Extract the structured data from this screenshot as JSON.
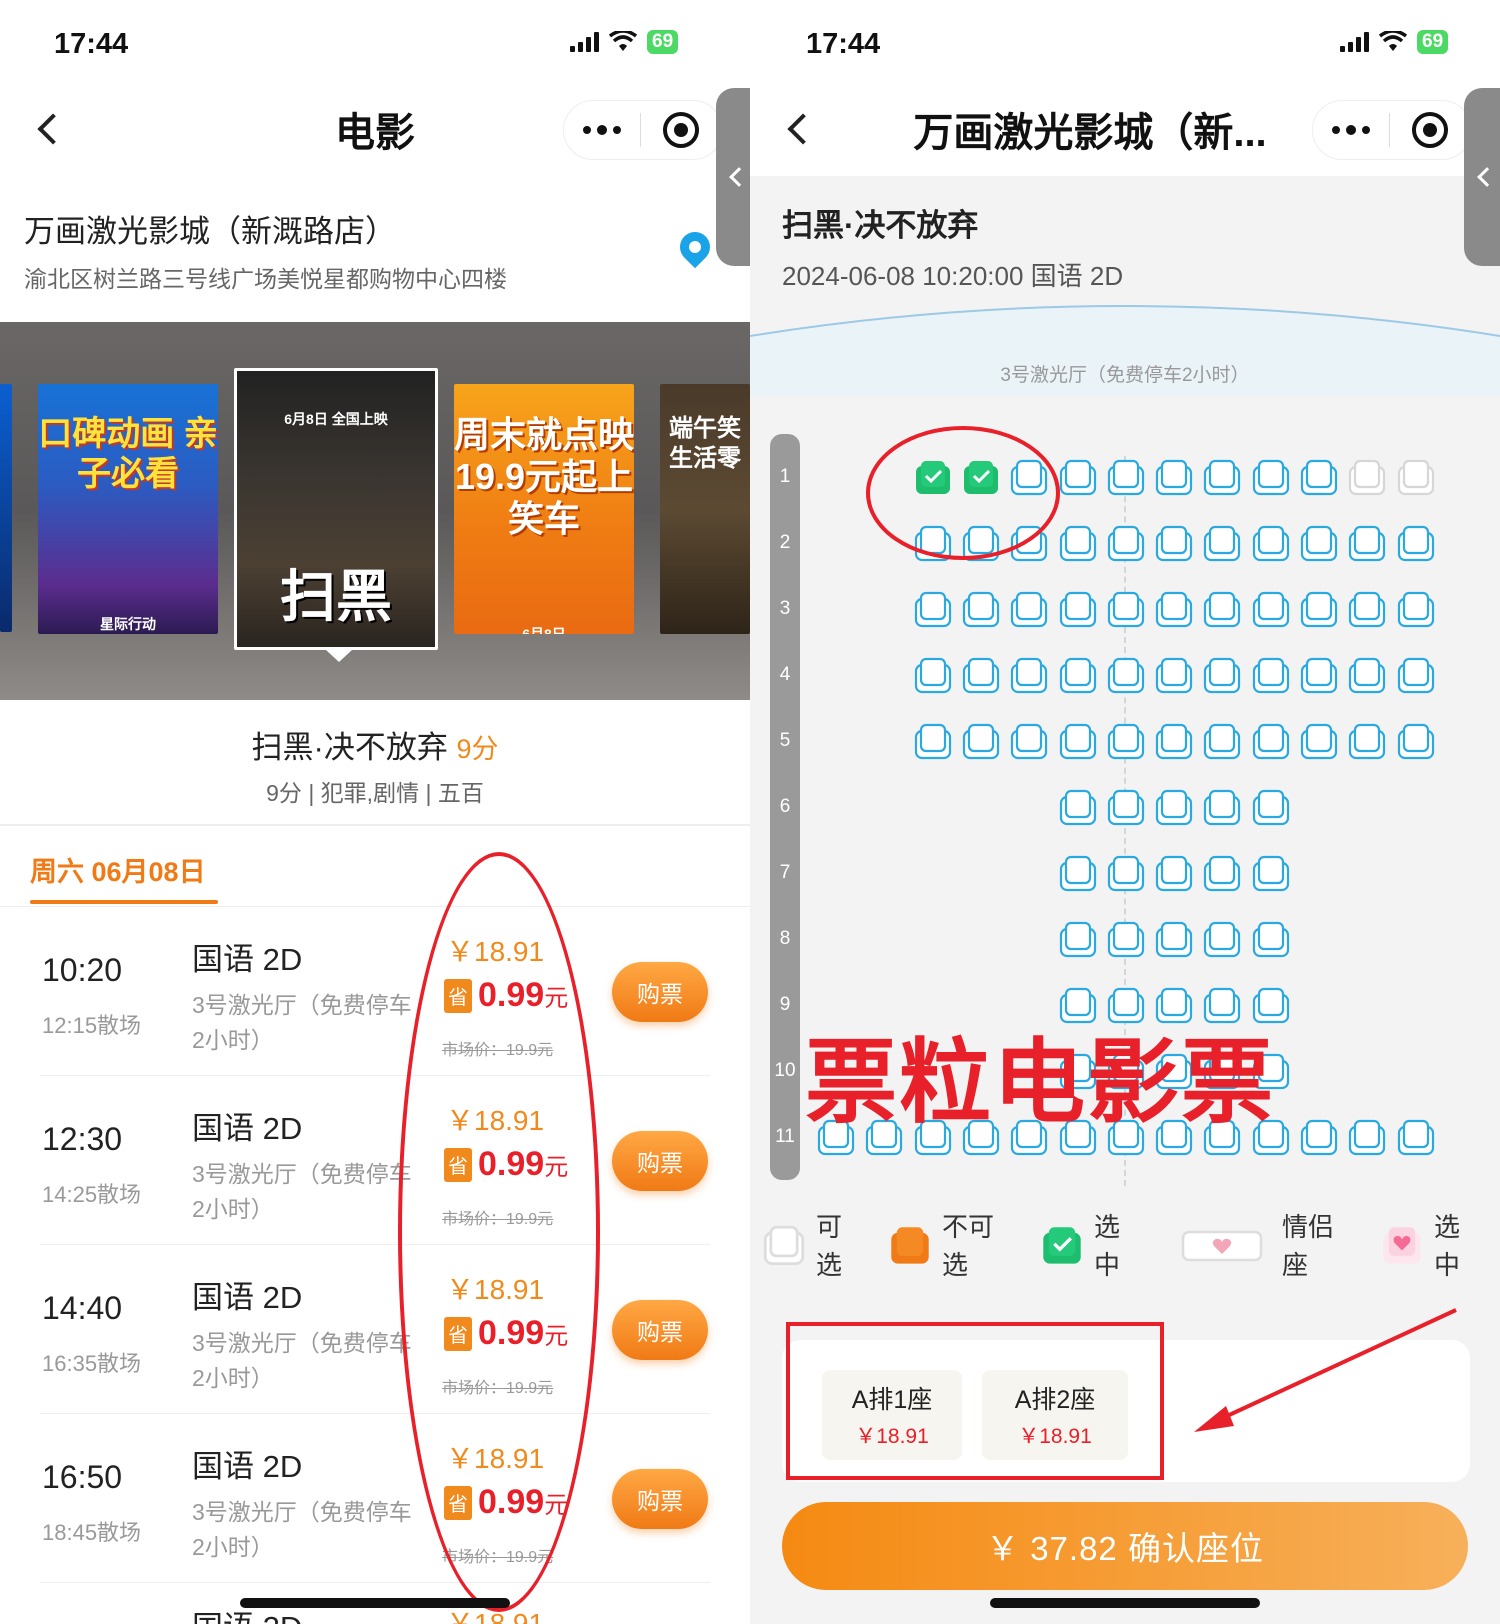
{
  "left": {
    "status": {
      "time": "17:44",
      "battery": "69"
    },
    "nav": {
      "title": "电影"
    },
    "cinema": {
      "name": "万画激光影城（新溉路店）",
      "address": "渝北区树兰路三号线广场美悦星都购物中心四楼"
    },
    "posters": [
      {
        "title": "",
        "subtitle": ""
      },
      {
        "title": "口碑动画 亲子必看",
        "subtitle": "星际行动"
      },
      {
        "title": "扫黑",
        "subtitle": "6月8日 全国上映"
      },
      {
        "title": "周末就点映 19.9元起上笑车",
        "subtitle": "6月8日"
      },
      {
        "title": "端午笑 生活零",
        "subtitle": ""
      }
    ],
    "movie": {
      "title": "扫黑·决不放弃",
      "score": "9分",
      "meta": "9分 | 犯罪,剧情 | 五百"
    },
    "date_tab": "周六 06月08日",
    "showtimes": [
      {
        "start": "10:20",
        "end": "12:15散场",
        "lang": "国语 2D",
        "hall": "3号激光厅（免费停车2小时）",
        "price": "￥18.91",
        "sale": "0.99",
        "unit": "元",
        "market": "市场价：19.9元",
        "buy": "购票"
      },
      {
        "start": "12:30",
        "end": "14:25散场",
        "lang": "国语 2D",
        "hall": "3号激光厅（免费停车2小时）",
        "price": "￥18.91",
        "sale": "0.99",
        "unit": "元",
        "market": "市场价：19.9元",
        "buy": "购票"
      },
      {
        "start": "14:40",
        "end": "16:35散场",
        "lang": "国语 2D",
        "hall": "3号激光厅（免费停车2小时）",
        "price": "￥18.91",
        "sale": "0.99",
        "unit": "元",
        "market": "市场价：19.9元",
        "buy": "购票"
      },
      {
        "start": "16:50",
        "end": "18:45散场",
        "lang": "国语 2D",
        "hall": "3号激光厅（免费停车2小时）",
        "price": "￥18.91",
        "sale": "0.99",
        "unit": "元",
        "market": "市场价：19.9元",
        "buy": "购票"
      }
    ],
    "partial_row": {
      "lang": "国语 2D",
      "price": "￥18.91"
    },
    "sheng": "省"
  },
  "right": {
    "status": {
      "time": "17:44",
      "battery": "69"
    },
    "nav": {
      "title": "万画激光影城（新..."
    },
    "movie": {
      "title": "扫黑·决不放弃",
      "info": "2024-06-08 10:20:00 国语 2D"
    },
    "hall": "3号激光厅（免费停车2小时）",
    "row_numbers": [
      "1",
      "2",
      "3",
      "4",
      "5",
      "6",
      "7",
      "8",
      "9",
      "10",
      "11"
    ],
    "seat_rows": [
      {
        "cols": [
          3,
          4,
          5,
          6,
          7,
          8,
          9,
          10,
          11,
          12,
          13
        ],
        "selected": [
          3,
          4
        ],
        "white": [
          12,
          13
        ]
      },
      {
        "cols": [
          3,
          4,
          5,
          6,
          7,
          8,
          9,
          10,
          11,
          12,
          13
        ],
        "selected": [],
        "white": []
      },
      {
        "cols": [
          3,
          4,
          5,
          6,
          7,
          8,
          9,
          10,
          11,
          12,
          13
        ],
        "selected": [],
        "white": []
      },
      {
        "cols": [
          3,
          4,
          5,
          6,
          7,
          8,
          9,
          10,
          11,
          12,
          13
        ],
        "selected": [],
        "white": []
      },
      {
        "cols": [
          3,
          4,
          5,
          6,
          7,
          8,
          9,
          10,
          11,
          12,
          13
        ],
        "selected": [],
        "white": []
      },
      {
        "cols": [
          6,
          7,
          8,
          9,
          10
        ],
        "selected": [],
        "white": []
      },
      {
        "cols": [
          6,
          7,
          8,
          9,
          10
        ],
        "selected": [],
        "white": []
      },
      {
        "cols": [
          6,
          7,
          8,
          9,
          10
        ],
        "selected": [],
        "white": []
      },
      {
        "cols": [
          6,
          7,
          8,
          9,
          10
        ],
        "selected": [],
        "white": []
      },
      {
        "cols": [
          6,
          7,
          8,
          9,
          10
        ],
        "selected": [],
        "white": []
      },
      {
        "cols": [
          1,
          2,
          3,
          4,
          5,
          6,
          7,
          8,
          9,
          10,
          11,
          12,
          13
        ],
        "selected": [],
        "white": []
      }
    ],
    "watermark": "票粒电影票",
    "legend": [
      {
        "label": "可选",
        "type": "available"
      },
      {
        "label": "不可选",
        "type": "sold"
      },
      {
        "label": "选中",
        "type": "selected"
      },
      {
        "label": "情侣座",
        "type": "couple"
      },
      {
        "label": "选中",
        "type": "couple-selected"
      }
    ],
    "selected_seats": [
      {
        "label": "A排1座",
        "price": "￥18.91"
      },
      {
        "label": "A排2座",
        "price": "￥18.91"
      }
    ],
    "confirm": "￥ 37.82 确认座位"
  },
  "colors": {
    "accent": "#f08a1c",
    "red": "#e8202a",
    "seat": "#2aa8e0",
    "selected": "#1dbd6e"
  }
}
